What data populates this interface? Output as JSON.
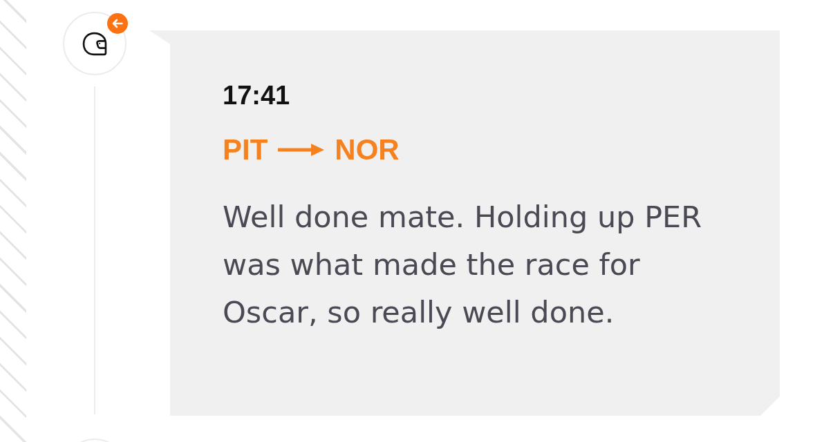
{
  "messages": [
    {
      "time": "17:41",
      "from": "PIT",
      "to": "NOR",
      "text": "Well done mate. Holding up PER was what made the race for Oscar, so really well done."
    }
  ]
}
